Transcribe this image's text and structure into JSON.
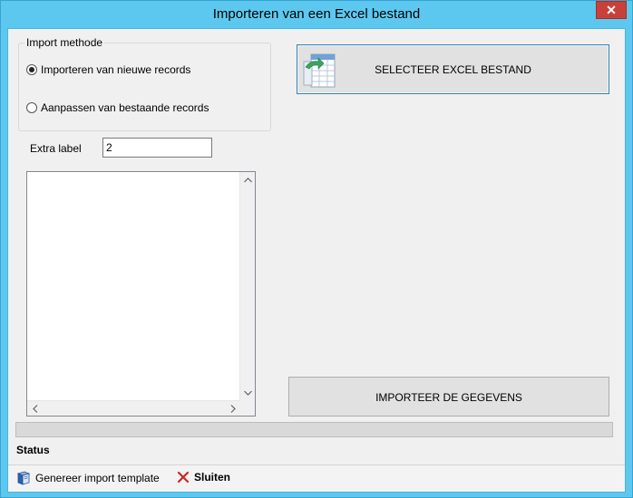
{
  "window": {
    "title": "Importeren van een Excel bestand",
    "close_glyph": "✕"
  },
  "import_method": {
    "legend": "Import methode",
    "options": [
      {
        "label": "Importeren van nieuwe records",
        "checked": true
      },
      {
        "label": "Aanpassen van bestaande records",
        "checked": false
      }
    ]
  },
  "extra_label": {
    "label": "Extra label",
    "value": "2"
  },
  "buttons": {
    "select_excel": "SELECTEER EXCEL BESTAND",
    "import_data": "IMPORTEER DE GEGEVENS"
  },
  "progress": {
    "value": 0
  },
  "status": {
    "label": "Status"
  },
  "toolbar": {
    "generate_template": "Genereer import template",
    "close": "Sluiten"
  },
  "icons": {
    "excel": "excel-import-icon",
    "template": "book-icon",
    "close": "red-x-icon"
  },
  "colors": {
    "titlebar": "#5dc8ef",
    "close_button": "#c7413a",
    "select_border": "#3c7fb1"
  }
}
